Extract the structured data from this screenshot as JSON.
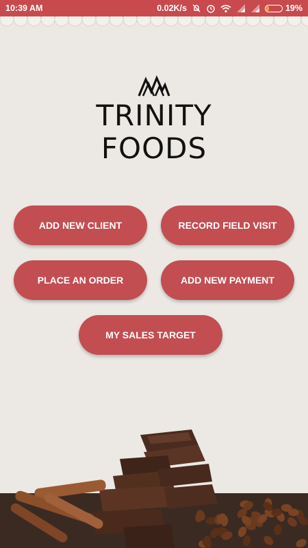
{
  "status_bar": {
    "time": "10:39 AM",
    "speed": "0.02K/s",
    "battery": "19%",
    "battery_level": 0.19,
    "icons": [
      "mute-icon",
      "alarm-icon",
      "wifi-icon",
      "signal-icon",
      "signal-icon",
      "battery-icon"
    ]
  },
  "brand": {
    "line1": "TRINITY",
    "line2": "FOODS"
  },
  "actions": {
    "add_new_client": "ADD NEW CLIENT",
    "record_field_visit": "RECORD FIELD VISIT",
    "place_an_order": "PLACE AN ORDER",
    "add_new_payment": "ADD NEW PAYMENT",
    "my_sales_target": "MY SALES TARGET"
  },
  "colors": {
    "primary": "#c24e52",
    "status_bar": "#c84a4d",
    "background": "#ece9e4",
    "text_on_primary": "#ffffff",
    "logo": "#111111"
  }
}
